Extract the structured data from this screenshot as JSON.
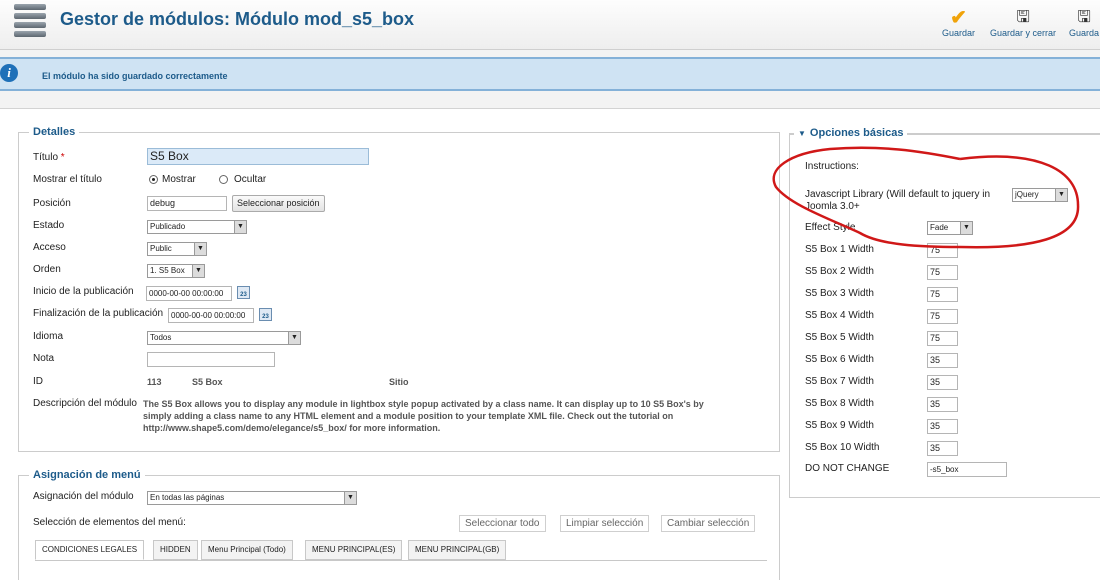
{
  "header": {
    "title": "Gestor de módulos: Módulo mod_s5_box",
    "toolbar": [
      {
        "label": "Guardar",
        "icon": "check-icon"
      },
      {
        "label": "Guardar y cerrar",
        "icon": "save-close-icon"
      },
      {
        "label": "Guarda",
        "icon": "save-new-icon"
      }
    ]
  },
  "message": {
    "icon": "info-icon",
    "text": "El módulo ha sido guardado correctamente"
  },
  "details": {
    "legend": "Detalles",
    "title_label": "Título",
    "title_required": "*",
    "title_value": "S5 Box",
    "show_title_label": "Mostrar el título",
    "show_title_options": [
      "Mostrar",
      "Ocultar"
    ],
    "position_label": "Posición",
    "position_value": "debug",
    "select_position_button": "Seleccionar posición",
    "state_label": "Estado",
    "state_value": "Publicado",
    "access_label": "Acceso",
    "access_value": "Public",
    "order_label": "Orden",
    "order_value": "1. S5 Box",
    "publish_up_label": "Inicio de la publicación",
    "publish_up_value": "0000-00-00 00:00:00",
    "publish_down_label": "Finalización de la publicación",
    "publish_down_value": "0000-00-00 00:00:00",
    "calendar_icon_text": "23",
    "language_label": "Idioma",
    "language_value": "Todos",
    "note_label": "Nota",
    "note_value": "",
    "id_label": "ID",
    "id_value": "113",
    "id_module_name": "S5 Box",
    "id_site": "Sitio",
    "description_label": "Descripción del módulo",
    "description_lines": [
      "The S5 Box allows you to display any module in lightbox style popup activated by a class name. It can display up to 10 S5 Box's by",
      "simply adding a class name to any HTML element and a module position to your template XML file. Check out the tutorial on",
      "http://www.shape5.com/demo/elegance/s5_box/ for more information."
    ]
  },
  "menu_assignment": {
    "legend": "Asignación de menú",
    "assignment_label": "Asignación del módulo",
    "assignment_value": "En todas las páginas",
    "selection_label": "Selección de elementos del menú:",
    "buttons": [
      "Seleccionar todo",
      "Limpiar selección",
      "Cambiar selección"
    ],
    "tabs": [
      "CONDICIONES LEGALES",
      "HIDDEN",
      "Menu Principal (Todo)",
      "MENU PRINCIPAL(ES)",
      "MENU PRINCIPAL(GB)"
    ]
  },
  "options": {
    "header": "Opciones básicas",
    "instructions_label": "Instructions:",
    "js_library_label_line1": "Javascript Library (Will default to jquery in",
    "js_library_label_line2": "Joomla 3.0+",
    "js_library_value": "jQuery",
    "effect_label": "Effect Style",
    "effect_value": "Fade",
    "widths": [
      {
        "label": "S5 Box 1 Width",
        "value": "75"
      },
      {
        "label": "S5 Box 2 Width",
        "value": "75"
      },
      {
        "label": "S5 Box 3 Width",
        "value": "75"
      },
      {
        "label": "S5 Box 4 Width",
        "value": "75"
      },
      {
        "label": "S5 Box 5 Width",
        "value": "75"
      },
      {
        "label": "S5 Box 6 Width",
        "value": "35"
      },
      {
        "label": "S5 Box 7 Width",
        "value": "35"
      },
      {
        "label": "S5 Box 8 Width",
        "value": "35"
      },
      {
        "label": "S5 Box 9 Width",
        "value": "35"
      },
      {
        "label": "S5 Box 10 Width",
        "value": "35"
      }
    ],
    "do_not_change_label": "DO NOT CHANGE",
    "do_not_change_value": "-s5_box"
  },
  "colors": {
    "accent": "#1d5b8a",
    "message_bg": "#cfe3f3",
    "annotation": "#d01818"
  }
}
